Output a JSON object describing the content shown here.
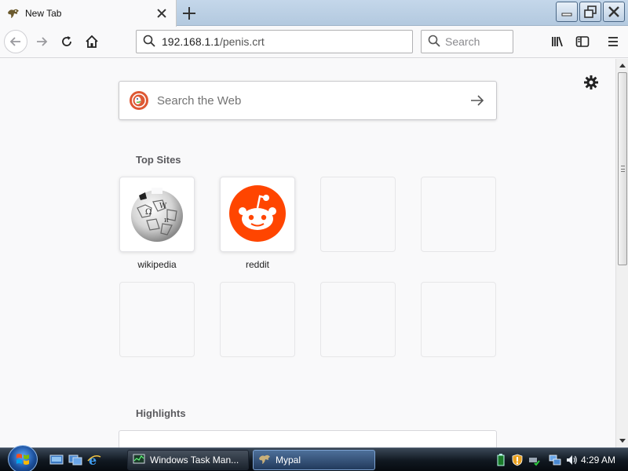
{
  "browser": {
    "tab": {
      "title": "New Tab",
      "favicon": "mypal-icon"
    },
    "new_tab_icon": "plus-icon",
    "window_controls": [
      "minimize-icon",
      "restore-icon",
      "close-icon"
    ]
  },
  "navbar": {
    "url_host": "192.168.1.1",
    "url_path": "/penis.crt",
    "search_placeholder": "Search",
    "icons": [
      "back-arrow-icon",
      "forward-arrow-icon",
      "reload-icon",
      "home-icon",
      "library-icon",
      "sidebar-icon",
      "menu-icon"
    ]
  },
  "newtab": {
    "search_placeholder": "Search the Web",
    "search_engine_icon": "duckduckgo-icon",
    "top_sites_title": "Top Sites",
    "highlights_title": "Highlights",
    "top_sites": [
      {
        "label": "wikipedia",
        "icon": "wikipedia-globe-icon"
      },
      {
        "label": "reddit",
        "icon": "reddit-icon"
      },
      {
        "label": ""
      },
      {
        "label": ""
      },
      {
        "label": ""
      },
      {
        "label": ""
      },
      {
        "label": ""
      },
      {
        "label": ""
      }
    ],
    "colors": {
      "reddit": "#ff4500",
      "duckduckgo": "#de5833"
    }
  },
  "taskbar": {
    "tasks": [
      {
        "label": "Windows Task Man...",
        "icon": "task-manager-icon",
        "active": false
      },
      {
        "label": "Mypal",
        "icon": "mypal-icon",
        "active": true
      }
    ],
    "quick_launch": [
      "show-desktop-icon",
      "switch-windows-icon",
      "internet-explorer-icon"
    ],
    "tray_icons": [
      "battery-icon",
      "security-shield-icon",
      "safely-remove-icon",
      "network-icon",
      "volume-icon"
    ],
    "clock": "4:29 AM"
  }
}
